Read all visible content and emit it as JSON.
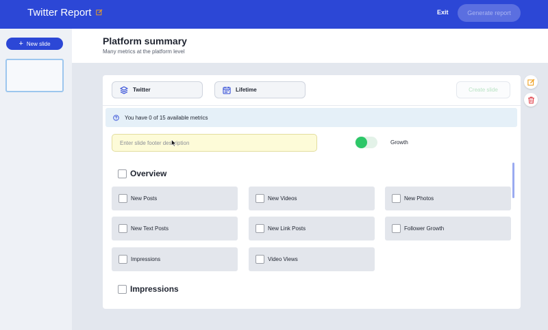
{
  "header": {
    "app_title": "Twitter Report",
    "exit_label": "Exit",
    "generate_label": "Generate report"
  },
  "sidebar": {
    "new_slide_label": "New slide"
  },
  "page": {
    "title": "Platform summary",
    "subtitle": "Many metrics at the platform level"
  },
  "slide": {
    "platform_label": "Twitter",
    "period_label": "Lifetime",
    "create_slide_label": "Create slide",
    "info_text": "You have 0 of 15 available metrics",
    "footer_placeholder": "Enter slide footer description",
    "growth_label": "Growth",
    "growth_enabled": true
  },
  "sections": [
    {
      "title": "Overview",
      "metrics": [
        "New Posts",
        "New Videos",
        "New Photos",
        "New Text Posts",
        "New Link Posts",
        "Follower Growth",
        "Impressions",
        "Video Views"
      ]
    },
    {
      "title": "Impressions"
    }
  ],
  "icons": {
    "edit": "edit-icon",
    "plus": "plus-icon",
    "layers": "layers-icon",
    "calendar": "calendar-icon",
    "info": "info-icon",
    "trash": "trash-icon"
  },
  "colors": {
    "brand_blue": "#2c47d6",
    "toggle_green": "#2dc768",
    "edit_orange": "#f0a020",
    "delete_red": "#e0404a",
    "info_bg": "#e5f0f8",
    "input_bg": "#fdfbd8"
  }
}
